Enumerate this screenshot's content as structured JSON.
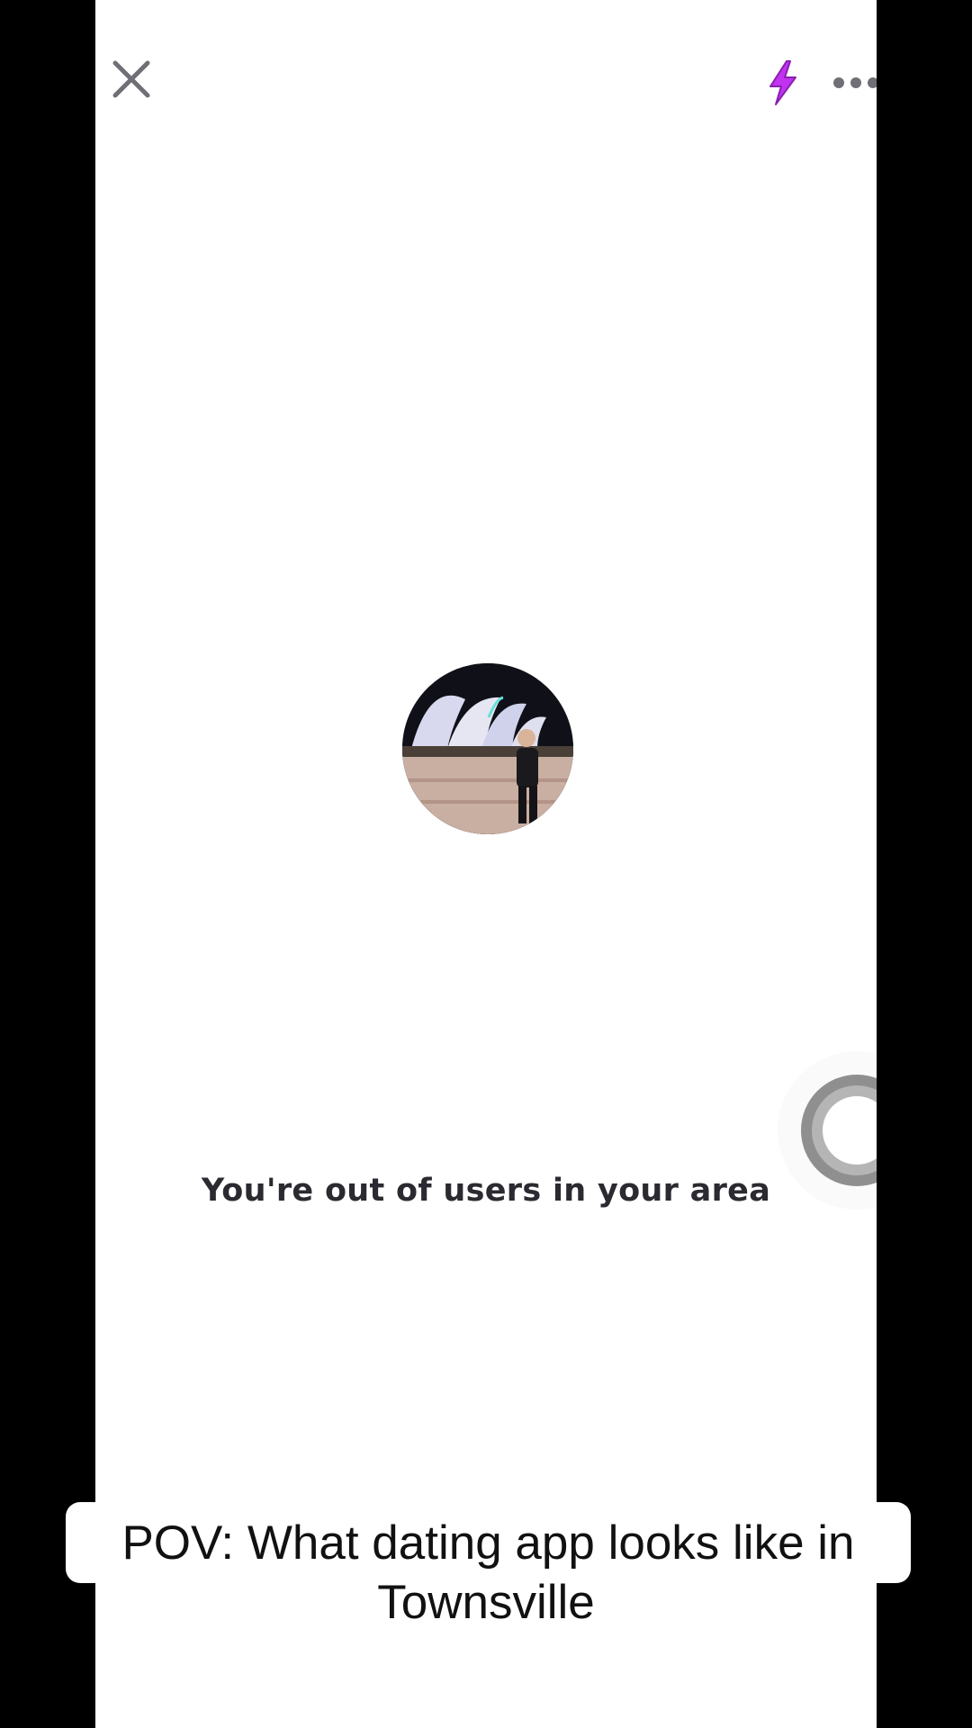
{
  "header": {
    "close_icon": "close-icon",
    "boost_icon": "lightning-bolt-icon",
    "more_icon": "more-dots-icon",
    "accent_color": "#c133f0"
  },
  "main": {
    "avatar_description": "profile-photo",
    "empty_message": "You're out of users in your area",
    "radar_icon": "radar-pulse-icon"
  },
  "caption": {
    "line1": "POV: What dating app looks like in",
    "line2": "Townsville"
  }
}
